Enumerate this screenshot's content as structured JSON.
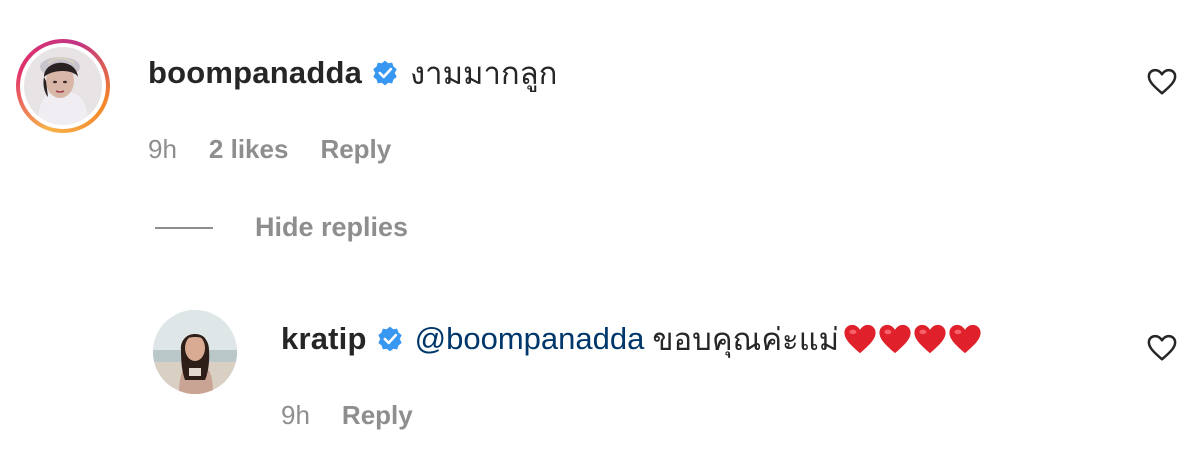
{
  "comments": [
    {
      "username": "boompanadda",
      "verified": true,
      "text": "งามมากลูก",
      "time": "9h",
      "likes": "2 likes",
      "reply_label": "Reply"
    }
  ],
  "hide_replies_label": "Hide replies",
  "replies": [
    {
      "username": "kratip",
      "verified": true,
      "mention": "@boompanadda",
      "text": "ขอบคุณค่ะแม่",
      "emoji_hearts": 4,
      "time": "9h",
      "reply_label": "Reply"
    }
  ],
  "colors": {
    "username": "#262626",
    "meta": "#8e8e8e",
    "mention": "#00376b",
    "verified": "#3897f0",
    "heart_emoji": "#e0212c"
  }
}
